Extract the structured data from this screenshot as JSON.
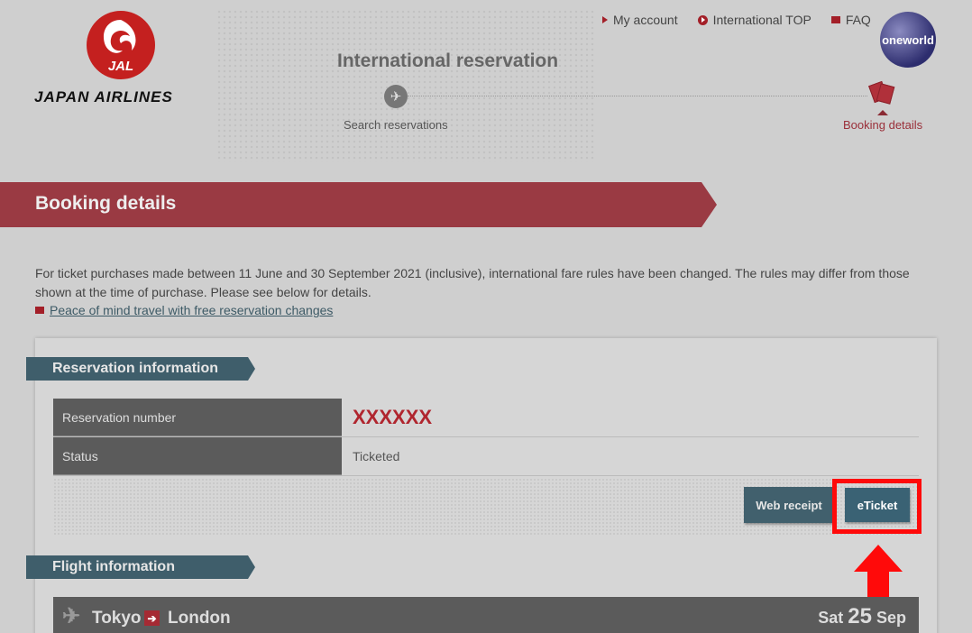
{
  "brand": {
    "logo_mark": "JAL",
    "name": "JAPAN AIRLINES",
    "alliance": "oneworld"
  },
  "top_nav": [
    {
      "label": "My account",
      "icon": "triangle-bullet-icon"
    },
    {
      "label": "International TOP",
      "icon": "circle-arrow-icon"
    },
    {
      "label": "FAQ",
      "icon": "square-bullet-icon"
    }
  ],
  "header": {
    "title": "International reservation"
  },
  "steps": {
    "search": "Search reservations",
    "booking": "Booking details"
  },
  "banner": {
    "title": "Booking details"
  },
  "notice": {
    "text": "For ticket purchases made between 11 June and 30 September 2021 (inclusive), international fare rules have been changed. The rules may differ from those shown at the time of purchase. Please see below for details.",
    "link": "Peace of mind travel with free reservation changes"
  },
  "reservation": {
    "section_title": "Reservation information",
    "rows": [
      {
        "label": "Reservation number",
        "value": "XXXXXX"
      },
      {
        "label": "Status",
        "value": "Ticketed"
      }
    ],
    "buttons": {
      "receipt": "Web receipt",
      "eticket": "eTicket"
    }
  },
  "flight": {
    "section_title": "Flight information",
    "from": "Tokyo",
    "to": "London",
    "weekday": "Sat",
    "day": "25",
    "month": "Sep"
  },
  "colors": {
    "brand_red": "#a31f28",
    "section_blue": "#3f5e6b",
    "highlight": "#ff0a0a"
  }
}
